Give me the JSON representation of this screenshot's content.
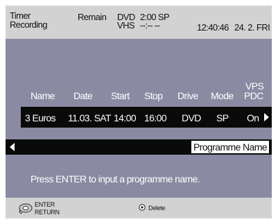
{
  "header": {
    "title_line1": "Timer",
    "title_line2": "Recording",
    "remain_label": "Remain",
    "dvd_label": "DVD",
    "dvd_remain": "2:00 SP",
    "vhs_label": "VHS",
    "vhs_remain": "--:--  --",
    "clock": "12:40:46",
    "date": "24. 2. FRI"
  },
  "table": {
    "columns": {
      "name": "Name",
      "date": "Date",
      "start": "Start",
      "stop": "Stop",
      "drive": "Drive",
      "mode": "Mode",
      "vps_line1": "VPS",
      "vps_line2": "PDC"
    },
    "row": {
      "name": "3 Euros",
      "date": "11.03. SAT",
      "start": "14:00",
      "stop": "16:00",
      "drive": "DVD",
      "mode": "SP",
      "vps": "On"
    }
  },
  "selection_bar": {
    "label": "Programme Name"
  },
  "message": "Press ENTER to input a programme name.",
  "footer": {
    "enter_label": "ENTER",
    "return_label": "RETURN",
    "delete_label": "Delete"
  },
  "colors": {
    "panel_bg": "#8a8aa2",
    "header_bg": "#d2d2d2",
    "row_bg": "#0a0a0a"
  },
  "icons": [
    "remote-navigation-icon",
    "delete-button-icon",
    "arrow-left-icon",
    "arrow-right-icon"
  ]
}
